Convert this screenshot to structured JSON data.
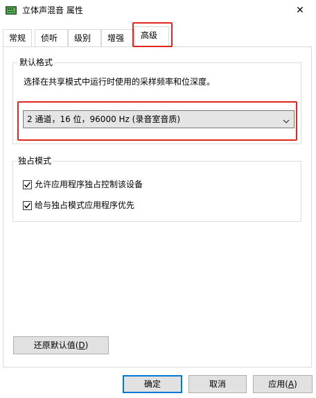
{
  "window": {
    "title": "立体声混音 属性",
    "close_glyph": "✕"
  },
  "tabs": [
    {
      "label": "常规"
    },
    {
      "label": "侦听"
    },
    {
      "label": "级别"
    },
    {
      "label": "增强"
    },
    {
      "label": "高级"
    }
  ],
  "active_tab": "高级",
  "default_format": {
    "group_title": "默认格式",
    "description": "选择在共享模式中运行时使用的采样频率和位深度。",
    "selected_value": "2 通道，16 位，96000 Hz (录音室音质)"
  },
  "exclusive_mode": {
    "group_title": "独占模式",
    "options": [
      {
        "label": "允许应用程序独占控制该设备",
        "checked": true
      },
      {
        "label": "给与独占模式应用程序优先",
        "checked": true
      }
    ]
  },
  "buttons": {
    "restore_defaults_prefix": "还原默认值(",
    "restore_defaults_key": "D",
    "restore_defaults_suffix": ")",
    "ok": "确定",
    "cancel": "取消",
    "apply_prefix": "应用(",
    "apply_key": "A",
    "apply_suffix": ")"
  },
  "colors": {
    "highlight_red": "#e0261f",
    "default_button_border": "#0078d7"
  }
}
